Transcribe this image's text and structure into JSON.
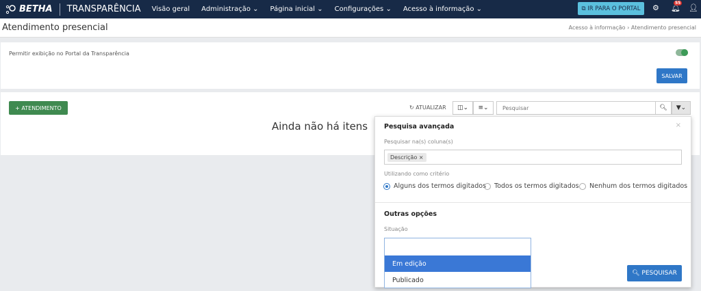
{
  "nav": {
    "logo": "BETHA",
    "brand": "TRANSPARÊNCIA",
    "menu": [
      "Visão geral",
      "Administração ⌄",
      "Página inicial ⌄",
      "Configurações ⌄",
      "Acesso à informação ⌄"
    ],
    "portal_button": "IR PARA O PORTAL",
    "notifications": "55"
  },
  "header": {
    "title": "Atendimento presencial",
    "breadcrumb": "Acesso à informação › Atendimento presencial"
  },
  "settings": {
    "permit_label": "Permitir exibição no Portal da Transparência",
    "permit_enabled": true,
    "save": "SALVAR"
  },
  "list": {
    "add_button": "ATENDIMENTO",
    "refresh": "ATUALIZAR",
    "search_placeholder": "Pesquisar",
    "empty": "Ainda não há itens"
  },
  "advanced": {
    "title": "Pesquisa avançada",
    "columns_label": "Pesquisar na(s) coluna(s)",
    "columns": [
      "Descrição"
    ],
    "criteria_label": "Utilizando como critério",
    "criteria": [
      "Alguns dos termos digitados",
      "Todos os termos digitados",
      "Nenhum dos termos digitados"
    ],
    "criteria_selected": 0,
    "other_title": "Outras opções",
    "status_label": "Situação",
    "status_options": [
      "Em edição",
      "Publicado"
    ],
    "status_highlighted": 0,
    "search_button": "PESQUISAR"
  },
  "colors": {
    "nav": "#172a47",
    "primary": "#2f77c7",
    "success": "#3f8a50",
    "info": "#5bc0de"
  }
}
